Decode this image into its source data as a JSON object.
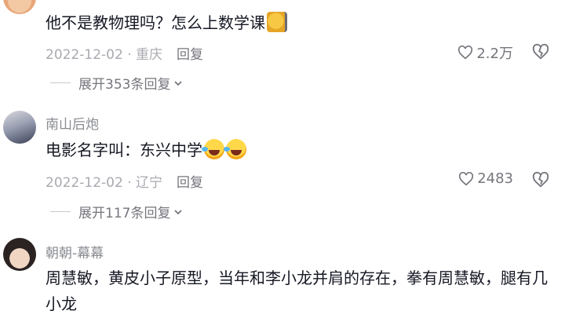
{
  "comments": [
    {
      "username": "",
      "text": "他不是教物理吗？怎么上数学课",
      "date": "2022-12-02",
      "location": "重庆",
      "reply_label": "回复",
      "likes": "2.2万",
      "expand_label": "展开353条回复"
    },
    {
      "username": "南山后炮",
      "text": "电影名字叫：东兴中学",
      "date": "2022-12-02",
      "location": "辽宁",
      "reply_label": "回复",
      "likes": "2483",
      "expand_label": "展开117条回复"
    },
    {
      "username": "朝朝-幕幕",
      "text": "周慧敏，黄皮小子原型，当年和李小龙并肩的存在，拳有周慧敏，腿有几小龙"
    }
  ],
  "meta_separator": " · ",
  "icons": {
    "heart": "heart-outline-icon",
    "dislike": "broken-heart-icon",
    "chevron": "chevron-down-icon",
    "emoji_cat": "cat-face-emoji",
    "emoji_laugh": "laughing-tears-emoji"
  }
}
